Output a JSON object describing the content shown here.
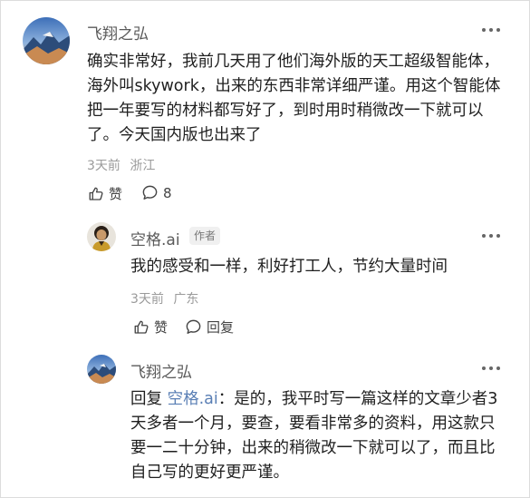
{
  "comments": [
    {
      "author": "飞翔之弘",
      "text": "确实非常好，我前几天用了他们海外版的天工超级智能体，海外叫skywork，出来的东西非常详细严谨。用这个智能体把一年要写的材料都写好了，到时用时稍微改一下就可以了。今天国内版也出来了",
      "time": "3天前",
      "location": "浙江",
      "like_label": "赞",
      "reply_count": "8"
    },
    {
      "author": "空格.ai",
      "author_tag": "作者",
      "text": "我的感受和一样，利好打工人，节约大量时间",
      "time": "3天前",
      "location": "广东",
      "like_label": "赞",
      "reply_label": "回复"
    },
    {
      "author": "飞翔之弘",
      "reply_prefix": "回复",
      "reply_to": "空格.ai",
      "text": "：是的，我平时写一篇这样的文章少者3天多者一个月，要查，要看非常多的资料，用这款只要一二十分钟，出来的稍微改一下就可以了，而且比自己写的更好更严谨。"
    }
  ],
  "icons": {
    "like": "thumbs-up-icon",
    "comment": "comment-bubble-icon",
    "more": "more-horizontal-icon"
  },
  "colors": {
    "mention": "#5a7fb5",
    "meta": "#9a9a9a"
  }
}
